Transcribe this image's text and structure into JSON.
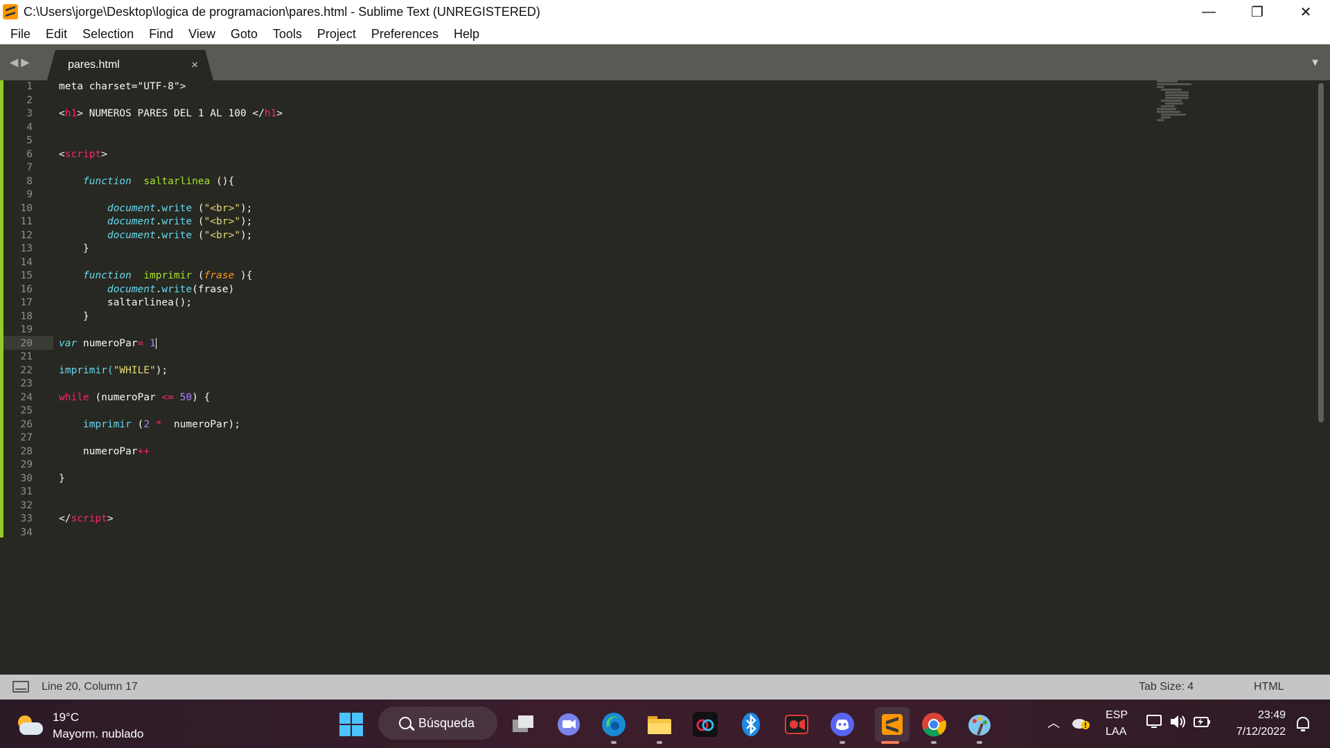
{
  "window": {
    "title": "C:\\Users\\jorge\\Desktop\\logica de programacion\\pares.html - Sublime Text (UNREGISTERED)",
    "controls": {
      "minimize": "—",
      "restore": "❐",
      "close": "✕"
    }
  },
  "menu": [
    "File",
    "Edit",
    "Selection",
    "Find",
    "View",
    "Goto",
    "Tools",
    "Project",
    "Preferences",
    "Help"
  ],
  "tabs": [
    {
      "label": "pares.html",
      "close": "×",
      "active": true
    }
  ],
  "editor": {
    "line_numbers": [
      "1",
      "2",
      "3",
      "4",
      "5",
      "6",
      "7",
      "8",
      "9",
      "10",
      "11",
      "12",
      "13",
      "14",
      "15",
      "16",
      "17",
      "18",
      "19",
      "20",
      "21",
      "22",
      "23",
      "24",
      "25",
      "26",
      "27",
      "28",
      "29",
      "30",
      "31",
      "32",
      "33",
      "34"
    ],
    "current_line": 20,
    "lines": {
      "l1": "meta charset=\"UTF-8\">",
      "l3_open": "<",
      "l3_tag": "h1",
      "l3_mid": "> NUMEROS PARES DEL 1 AL 100 </",
      "l3_tag2": "h1",
      "l3_close": ">",
      "l6_open": "<",
      "l6_tag": "script",
      "l6_close": ">",
      "l8_indent": "    ",
      "l8_kw": "function",
      "l8_sp": "  ",
      "l8_fn": "saltarlinea",
      "l8_rest": " (){",
      "l10_indent": "        ",
      "l10_obj": "document",
      "l10_dot": ".",
      "l10_method": "write",
      "l10_open": " (",
      "l10_str": "\"<br>\"",
      "l10_close": ");",
      "l13": "    }",
      "l15_indent": "    ",
      "l15_kw": "function",
      "l15_sp": "  ",
      "l15_fn": "imprimir",
      "l15_open": " (",
      "l15_param": "frase",
      "l15_close": " ){",
      "l16_indent": "        ",
      "l16_obj": "document",
      "l16_dot": ".",
      "l16_method": "write",
      "l16_rest": "(frase)",
      "l17": "        saltarlinea();",
      "l18": "    }",
      "l20_kw": "var",
      "l20_var": " numeroPar",
      "l20_op": "=",
      "l20_sp": " ",
      "l20_num": "1",
      "l22_fn": "imprimir(",
      "l22_str": "\"WHILE\"",
      "l22_close": ");",
      "l24_kw": "while",
      "l24_open": " (numeroPar ",
      "l24_op": "<=",
      "l24_sp": " ",
      "l24_num": "50",
      "l24_close": ") {",
      "l26_indent": "    ",
      "l26_fn": "imprimir",
      "l26_open": " (",
      "l26_num": "2",
      "l26_sp": " ",
      "l26_op": "*",
      "l26_rest": "  numeroPar);",
      "l28_var": "    numeroPar",
      "l28_op": "++",
      "l30": "}",
      "l33_open": "</",
      "l33_tag": "script",
      "l33_close": ">"
    }
  },
  "statusbar": {
    "position": "Line 20, Column 17",
    "tab_size": "Tab Size: 4",
    "syntax": "HTML"
  },
  "taskbar": {
    "weather": {
      "temp": "19°C",
      "desc": "Mayorm. nublado"
    },
    "search_label": "Búsqueda",
    "apps": [
      "task-view",
      "teams-chat",
      "edge",
      "file-explorer",
      "creative-cloud",
      "bluetooth",
      "screen-recorder",
      "discord",
      "sublime-text",
      "chrome",
      "paint"
    ],
    "lang_top": "ESP",
    "lang_bottom": "LAA",
    "time": "23:49",
    "date": "7/12/2022"
  },
  "colors": {
    "editor_bg": "#272822",
    "tag": "#f92672",
    "keyword": "#66d9ef",
    "function": "#a6e22e",
    "string": "#e6db74",
    "number": "#ae81ff",
    "param": "#fd971f"
  }
}
